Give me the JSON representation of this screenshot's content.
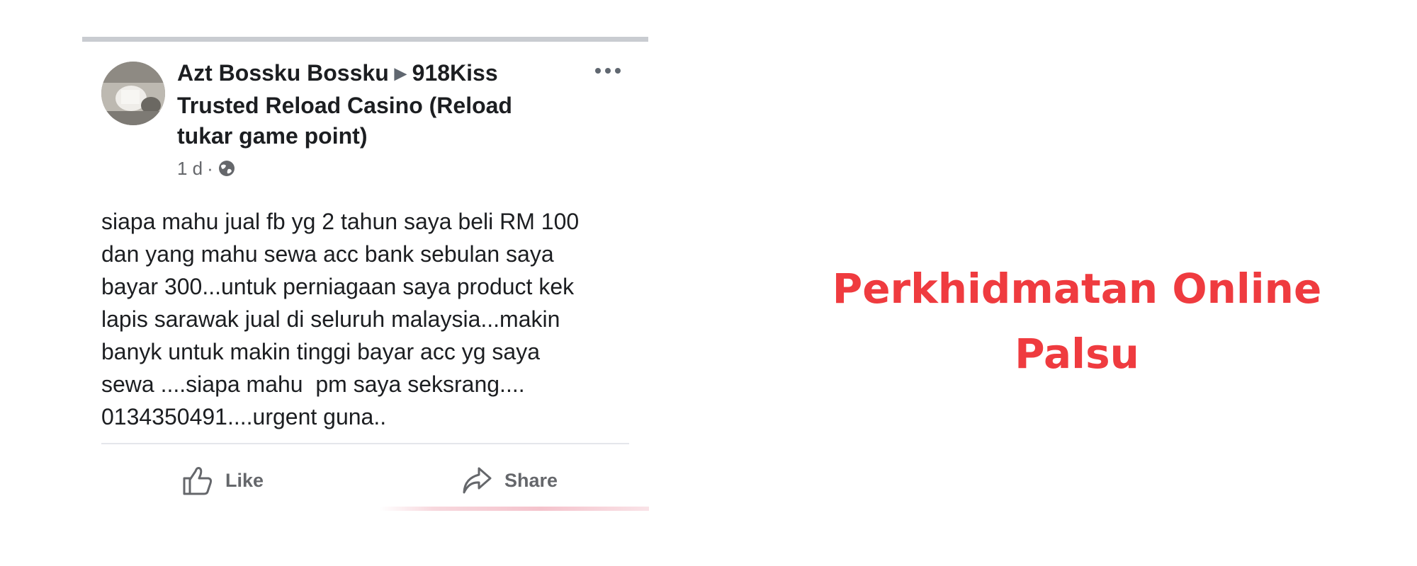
{
  "post": {
    "author": "Azt Bossku Bossku",
    "group": "918Kiss Trusted Reload Casino (Reload tukar game point)",
    "time": "1 d",
    "separator": "·",
    "body": "siapa mahu jual fb yg 2 tahun saya beli RM 100\ndan yang mahu sewa acc bank sebulan saya\nbayar 300...untuk perniagaan saya product kek\nlapis sarawak jual di seluruh malaysia...makin\nbanyk untuk makin tinggi bayar acc yg saya\nsewa ....siapa mahu  pm saya seksrang....\n0134350491....urgent guna..",
    "actions": {
      "like": "Like",
      "share": "Share"
    },
    "icons": {
      "audience": "globe-icon",
      "more": "more-options-icon",
      "like": "thumbs-up-icon",
      "share": "share-arrow-icon"
    }
  },
  "headline": {
    "line1": "Perkhidmatan Online",
    "line2": "Palsu",
    "color": "#ef3b3f"
  }
}
